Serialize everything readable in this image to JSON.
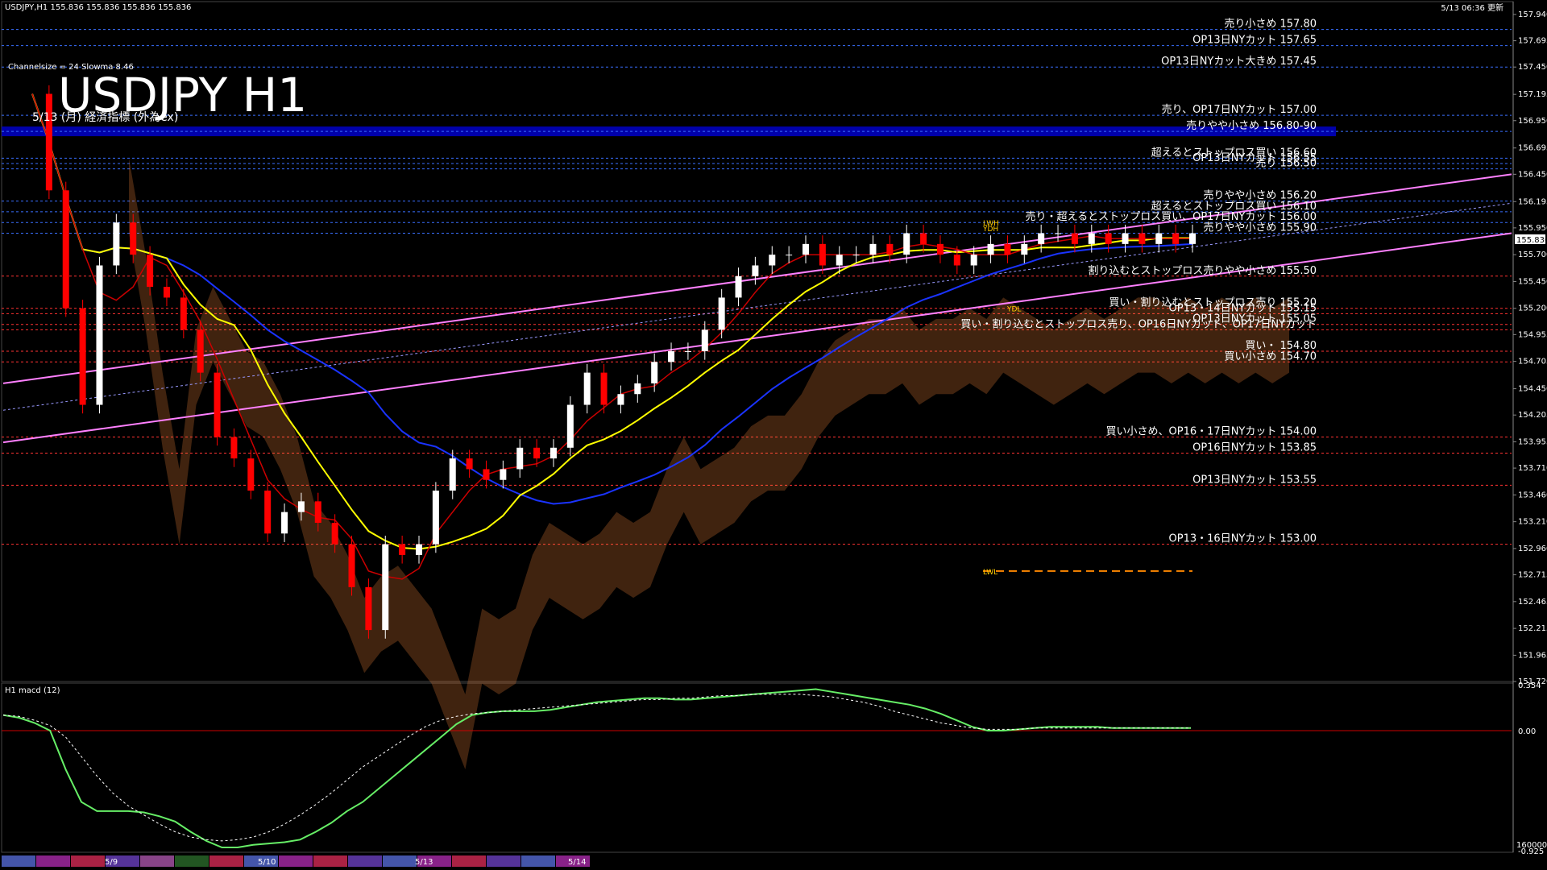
{
  "window": {
    "symbol_info": "USDJPY,H1  155.836 155.836 155.836 155.836",
    "update_time": "5/13 06:36 更新",
    "indicator_label": "Channelsize = 24  Slowma 8.46"
  },
  "chart_data": {
    "type": "candlestick",
    "title": "USDJPY H1",
    "subtitle": "5/13 (月) 経済指標 (外為ex)",
    "current_price": "155.836",
    "y_ticks": [
      "157.940",
      "157.695",
      "157.450",
      "157.195",
      "156.950",
      "156.695",
      "156.450",
      "156.195",
      "155.950",
      "155.700",
      "155.450",
      "155.200",
      "154.955",
      "154.705",
      "154.450",
      "154.205",
      "153.955",
      "153.710",
      "153.460",
      "153.210",
      "152.960",
      "152.715",
      "152.465",
      "152.215",
      "151.965",
      "151.720"
    ],
    "y_range": [
      151.72,
      158.06
    ],
    "levels": [
      {
        "label": "売り小さめ 157.80",
        "price": 157.8,
        "color": "#ffffff"
      },
      {
        "label": "OP13日NYカット 157.65",
        "price": 157.65,
        "color": "#ffffff"
      },
      {
        "label": "OP13日NYカット大きめ 157.45",
        "price": 157.45,
        "color": "#ffffff"
      },
      {
        "label": "売り、OP17日NYカット 157.00",
        "price": 157.0,
        "color": "#ffffff"
      },
      {
        "label": "売りやや小さめ 156.80-90",
        "price": 156.85,
        "color": "#ffffff",
        "band": true
      },
      {
        "label": "超えるとストップロス買い 156.60",
        "price": 156.6,
        "color": "#ffffff"
      },
      {
        "label": "OP13日NYカット 156.55",
        "price": 156.55,
        "color": "#ffffff"
      },
      {
        "label": "売り 156.50",
        "price": 156.5,
        "color": "#ffffff"
      },
      {
        "label": "売りやや小さめ 156.20",
        "price": 156.2,
        "color": "#ffffff"
      },
      {
        "label": "超えるとストップロス買い 156.10",
        "price": 156.1,
        "color": "#ffffff"
      },
      {
        "label": "売り・超えるとストップロス買い、OP17日NYカット 156.00",
        "price": 156.0,
        "color": "#ffffff"
      },
      {
        "label": "売りやや小さめ 155.90",
        "price": 155.9,
        "color": "#ffffff"
      },
      {
        "label": "割り込むとストップロス売りやや小さめ 155.50",
        "price": 155.5,
        "color": "#ffffff"
      },
      {
        "label": "買い・割り込むとストップロス売り 155.20",
        "price": 155.2,
        "color": "#ffffff"
      },
      {
        "label": "OP13・14日NYカット 155.15",
        "price": 155.15,
        "color": "#ffffff"
      },
      {
        "label": "OP13日NYカット 155.05",
        "price": 155.05,
        "color": "#ffffff"
      },
      {
        "label": "買い・割り込むとストップロス売り、OP16日NYカット、OP17日NYカット",
        "price": 155.0,
        "color": "#ffffff"
      },
      {
        "label": "買い・ 154.80",
        "price": 154.8,
        "color": "#ffffff"
      },
      {
        "label": "買い小さめ 154.70",
        "price": 154.7,
        "color": "#ffffff"
      },
      {
        "label": "買い小さめ、OP16・17日NYカット 154.00",
        "price": 154.0,
        "color": "#ffffff"
      },
      {
        "label": "OP16日NYカット 153.85",
        "price": 153.85,
        "color": "#ffffff"
      },
      {
        "label": "OP13日NYカット 153.55",
        "price": 153.55,
        "color": "#ffffff"
      },
      {
        "label": "OP13・16日NYカット 153.00",
        "price": 153.0,
        "color": "#ffffff"
      }
    ],
    "markers": [
      {
        "label": "LWH",
        "price": 156.0
      },
      {
        "label": "YDH",
        "price": 155.95
      },
      {
        "label": "YDL",
        "price": 155.2
      },
      {
        "label": "LWL",
        "price": 152.75
      }
    ],
    "date_labels": [
      "5/9",
      "5/10",
      "5/13",
      "5/14"
    ],
    "macd": {
      "label": "H1 macd (12)",
      "y_ticks": [
        "0.354",
        "0.00",
        "-0.925"
      ],
      "bottom_label": "160000",
      "range": [
        -0.925,
        0.354
      ],
      "main": [
        0.12,
        0.1,
        0.06,
        0.0,
        -0.3,
        -0.55,
        -0.62,
        -0.62,
        -0.62,
        -0.63,
        -0.66,
        -0.7,
        -0.78,
        -0.85,
        -0.9,
        -0.9,
        -0.88,
        -0.87,
        -0.86,
        -0.84,
        -0.78,
        -0.71,
        -0.62,
        -0.55,
        -0.45,
        -0.35,
        -0.25,
        -0.15,
        -0.05,
        0.05,
        0.12,
        0.14,
        0.15,
        0.15,
        0.15,
        0.16,
        0.18,
        0.2,
        0.22,
        0.23,
        0.24,
        0.25,
        0.25,
        0.24,
        0.24,
        0.25,
        0.26,
        0.27,
        0.28,
        0.29,
        0.3,
        0.31,
        0.32,
        0.3,
        0.28,
        0.26,
        0.24,
        0.22,
        0.2,
        0.17,
        0.13,
        0.08,
        0.03,
        0.0,
        0.0,
        0.01,
        0.02,
        0.03,
        0.03,
        0.03,
        0.03,
        0.02,
        0.02,
        0.02,
        0.02,
        0.02,
        0.02
      ],
      "signal": [
        0.12,
        0.11,
        0.08,
        0.04,
        -0.05,
        -0.2,
        -0.35,
        -0.48,
        -0.58,
        -0.65,
        -0.72,
        -0.78,
        -0.82,
        -0.84,
        -0.85,
        -0.84,
        -0.82,
        -0.78,
        -0.72,
        -0.65,
        -0.57,
        -0.48,
        -0.38,
        -0.28,
        -0.2,
        -0.12,
        -0.04,
        0.03,
        0.08,
        0.11,
        0.13,
        0.14,
        0.15,
        0.16,
        0.17,
        0.18,
        0.19,
        0.2,
        0.21,
        0.22,
        0.23,
        0.24,
        0.24,
        0.25,
        0.25,
        0.26,
        0.27,
        0.27,
        0.28,
        0.28,
        0.28,
        0.28,
        0.27,
        0.26,
        0.24,
        0.22,
        0.19,
        0.15,
        0.12,
        0.09,
        0.06,
        0.04,
        0.02,
        0.01,
        0.01,
        0.01,
        0.02,
        0.02,
        0.02,
        0.02,
        0.02,
        0.02,
        0.02,
        0.02,
        0.02,
        0.02,
        0.02
      ]
    },
    "price_path": [
      157.2,
      156.3,
      155.2,
      154.3,
      155.6,
      156.0,
      155.7,
      155.4,
      155.3,
      155.0,
      154.6,
      154.0,
      153.8,
      153.5,
      153.1,
      153.3,
      153.4,
      153.2,
      153.0,
      152.6,
      152.2,
      153.0,
      152.9,
      153.0,
      153.5,
      153.8,
      153.7,
      153.6,
      153.7,
      153.9,
      153.8,
      153.9,
      154.3,
      154.6,
      154.3,
      154.4,
      154.5,
      154.7,
      154.8,
      154.8,
      155.0,
      155.3,
      155.5,
      155.6,
      155.7,
      155.7,
      155.8,
      155.6,
      155.7,
      155.7,
      155.8,
      155.7,
      155.9,
      155.8,
      155.7,
      155.6,
      155.7,
      155.8,
      155.7,
      155.8,
      155.9,
      155.9,
      155.8,
      155.9,
      155.8,
      155.9,
      155.8,
      155.9,
      155.8,
      155.9
    ]
  },
  "colors": {
    "bull": "#ffffff",
    "bear": "#ff0000",
    "sma_yellow": "#ffff00",
    "sma_blue": "#1a33ff",
    "trend_pink": "#ff80ff",
    "cloud_orange": "#ffb070",
    "macd_green": "#66ee66",
    "macd_pink": "#ff8888"
  }
}
